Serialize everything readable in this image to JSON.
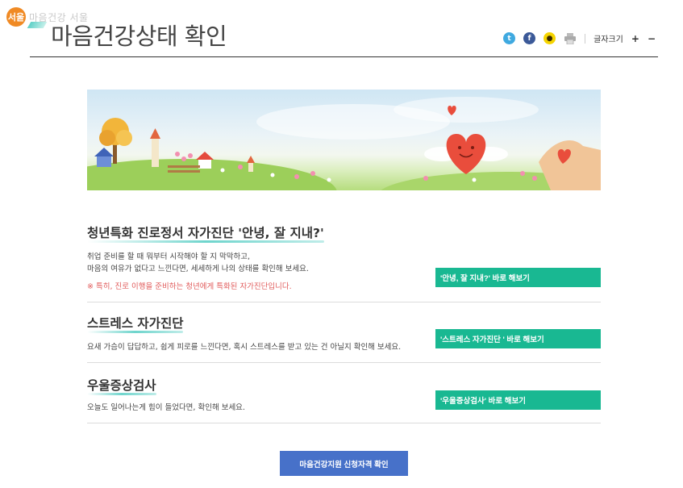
{
  "logo": {
    "mark": "서울",
    "text": "마음건강 서울"
  },
  "page_title": "마음건강상태 확인",
  "tools": {
    "icons": [
      "twitter-icon",
      "facebook-icon",
      "kakaotalk-icon",
      "print-icon"
    ],
    "font_size_label": "글자크기",
    "font_increase": "+",
    "font_decrease": "−"
  },
  "banner": {
    "description_icons": [
      "heart",
      "houses",
      "flowers",
      "hands"
    ]
  },
  "sections": [
    {
      "title": "청년특화 진로정서 자가진단 '안녕, 잘 지내?'",
      "desc_lines": [
        "취업 준비를 할 때 뭐부터 시작해야 할 지 막막하고,",
        "마음의 여유가 없다고 느낀다면, 세세하게 나의 상태를 확인해 보세요."
      ],
      "note": "※ 특히, 진로 이행을 준비하는 청년에게 특화된 자가진단입니다.",
      "button": "'안녕, 잘 지내?' 바로 해보기"
    },
    {
      "title": "스트레스 자가진단",
      "desc_lines": [
        "요새 가슴이 답답하고, 쉽게 피로를 느낀다면, 혹시 스트레스를 받고 있는 건 아닐지 확인해 보세요."
      ],
      "button": "'스트레스 자가진단 ' 바로 해보기"
    },
    {
      "title": "우울증상검사",
      "desc_lines": [
        "오늘도 일어나는게 힘이 들었다면, 확인해 보세요."
      ],
      "button": "'우울증상검사' 바로 해보기"
    }
  ],
  "apply_button": "마음건강지원 신청자격 확인",
  "colors": {
    "accent_green": "#19b892",
    "apply_blue": "#4771c9",
    "note_red": "#e15b5b"
  }
}
